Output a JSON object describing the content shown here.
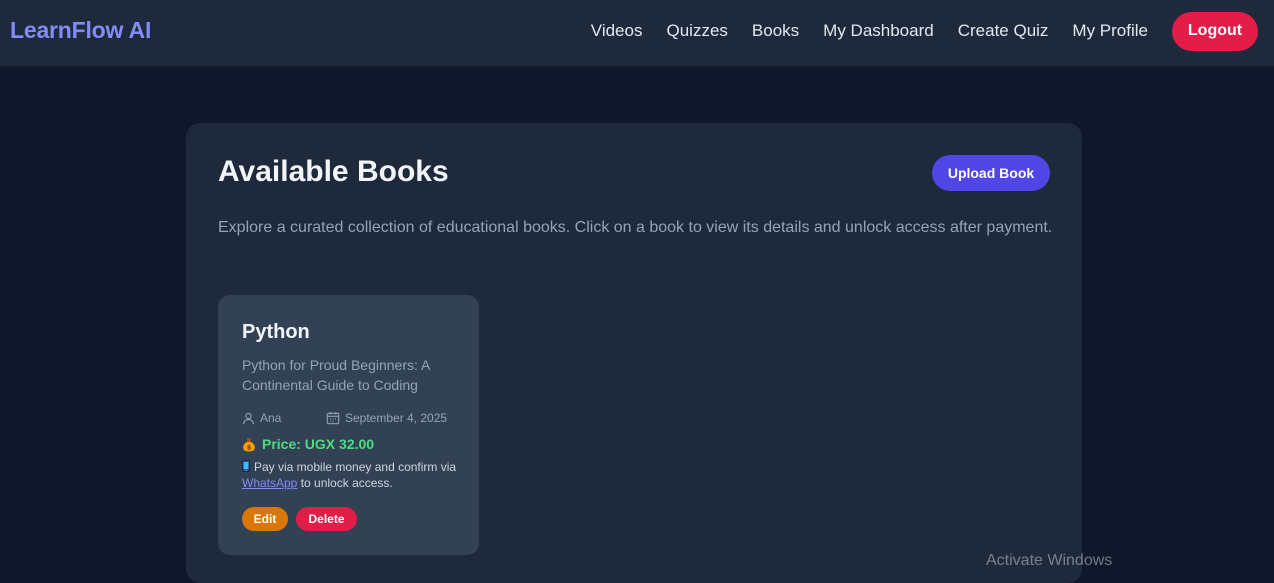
{
  "app": {
    "brand": "LearnFlow AI"
  },
  "nav": {
    "links": [
      "Videos",
      "Quizzes",
      "Books",
      "My Dashboard",
      "Create Quiz",
      "My Profile"
    ],
    "logout_label": "Logout"
  },
  "page": {
    "title": "Available Books",
    "upload_label": "Upload Book",
    "description": "Explore a curated collection of educational books. Click on a book to view its details and unlock access after payment."
  },
  "books": [
    {
      "title": "Python",
      "subtitle": "Python for Proud Beginners: A Continental Guide to Coding",
      "author": "Ana",
      "date": "September 4, 2025",
      "price": "Price: UGX 32.00",
      "pay_note_prefix": "Pay via mobile money and confirm via",
      "pay_link": "WhatsApp",
      "pay_note_suffix": "to unlock access.",
      "edit_label": "Edit",
      "delete_label": "Delete"
    }
  ],
  "watermark": "Activate Windows",
  "colors": {
    "background": "#0f172a",
    "navbar": "#1e293b",
    "brand": "#818cf8",
    "logout": "#e11d48",
    "upload": "#4f46e5",
    "price": "#4ade80",
    "edit": "#d97706",
    "delete": "#e11d48"
  }
}
